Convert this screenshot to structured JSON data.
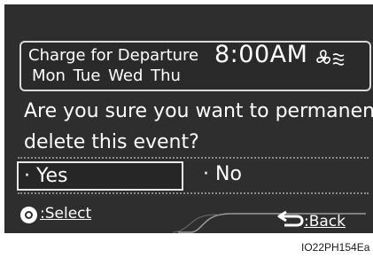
{
  "event": {
    "title": "Charge for Departure",
    "time": "8:00AM",
    "days": "Mon  Tue  Wed  Thu"
  },
  "dialog": {
    "line1": "Are you sure you want to permanently",
    "line2": "delete this event?",
    "yes_label": "· Yes",
    "no_label": "· No"
  },
  "footer": {
    "select_label": ":Select",
    "back_label": ":Back"
  },
  "image_code": "IO22PH154Ea",
  "icons": {
    "climate": "fan-icon",
    "select": "select-dial-icon",
    "back": "back-arrow-icon"
  },
  "colors": {
    "screen_bg": "#2e2e2e",
    "text": "#ffffff",
    "border": "#d9d9d9"
  }
}
